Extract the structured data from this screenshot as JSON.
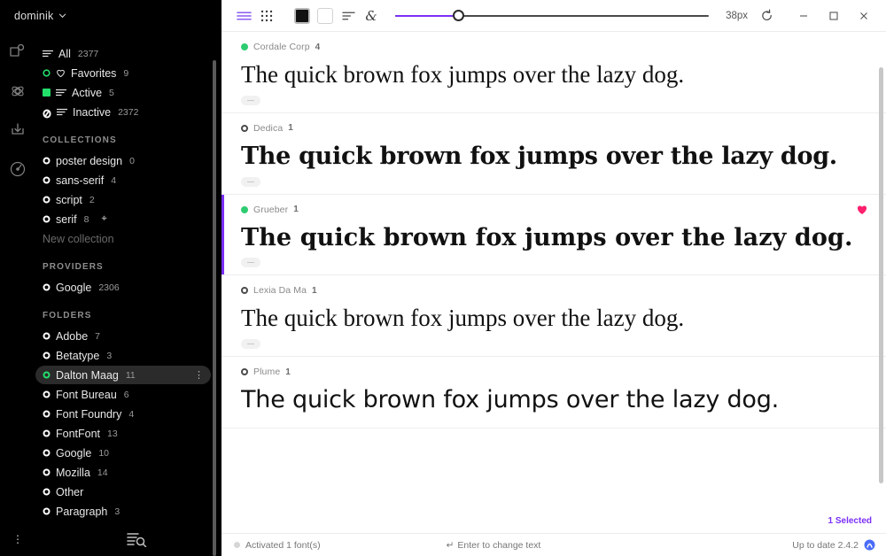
{
  "sidebar": {
    "user": {
      "name": "dominik",
      "chevron_icon": "chevron-down-icon"
    },
    "rail_icons": [
      "fonts-tag-icon",
      "settings-atom-icon",
      "install-download-icon",
      "broadcast-icon"
    ],
    "filters": [
      {
        "label": "All",
        "count": "2377",
        "icon": "lines-icon",
        "marker": "none"
      },
      {
        "label": "Favorites",
        "count": "9",
        "icon": "heart-icon",
        "marker": "ring-green"
      },
      {
        "label": "Active",
        "count": "5",
        "icon": "lines-icon",
        "marker": "square-green"
      },
      {
        "label": "Inactive",
        "count": "2372",
        "icon": "lines-icon",
        "marker": "slash-circle"
      }
    ],
    "collections_title": "COLLECTIONS",
    "collections": [
      {
        "label": "poster design",
        "count": "0"
      },
      {
        "label": "sans-serif",
        "count": "4"
      },
      {
        "label": "script",
        "count": "2"
      },
      {
        "label": "serif",
        "count": "8"
      }
    ],
    "new_collection_label": "New collection",
    "providers_title": "PROVIDERS",
    "providers": [
      {
        "label": "Google",
        "count": "2306"
      }
    ],
    "folders_title": "FOLDERS",
    "folders": [
      {
        "label": "Adobe",
        "count": "7",
        "selected": false
      },
      {
        "label": "Betatype",
        "count": "3",
        "selected": false
      },
      {
        "label": "Dalton Maag",
        "count": "11",
        "selected": true
      },
      {
        "label": "Font Bureau",
        "count": "6",
        "selected": false
      },
      {
        "label": "Font Foundry",
        "count": "4",
        "selected": false
      },
      {
        "label": "FontFont",
        "count": "13",
        "selected": false
      },
      {
        "label": "Google",
        "count": "10",
        "selected": false
      },
      {
        "label": "Mozilla",
        "count": "14",
        "selected": false
      },
      {
        "label": "Other",
        "count": "",
        "selected": false
      },
      {
        "label": "Paragraph",
        "count": "3",
        "selected": false
      }
    ],
    "footer": {
      "menu_icon": "more-vertical-icon",
      "search_icon": "list-search-icon"
    }
  },
  "toolbar": {
    "view_list_icon": "list-view-icon",
    "view_grid_icon": "grid-view-icon",
    "color_black_label": "black-swatch",
    "color_white_label": "white-swatch",
    "align_icon": "text-align-icon",
    "glyph_icon": "ampersand-glyph-icon",
    "size_value": "38px",
    "slider_percent": 20,
    "reset_icon": "reset-icon",
    "minimize_icon": "minimize-icon",
    "maximize_icon": "maximize-icon",
    "close_icon": "close-icon",
    "accent_color": "#7b2ff7"
  },
  "fonts": [
    {
      "name": "Cordale Corp",
      "count": "4",
      "marker": "dot-green",
      "favorite": false,
      "selected": false,
      "sample": "The quick brown fox jumps over the lazy dog."
    },
    {
      "name": "Dedica",
      "count": "1",
      "marker": "ring-dark",
      "favorite": false,
      "selected": false,
      "sample": "The quick brown fox jumps over the lazy dog."
    },
    {
      "name": "Grueber",
      "count": "1",
      "marker": "dot-green",
      "favorite": true,
      "selected": true,
      "sample": "The quick brown fox jumps over the lazy dog."
    },
    {
      "name": "Lexia Da Ma",
      "count": "1",
      "marker": "ring-dark",
      "favorite": false,
      "selected": false,
      "sample": "The quick brown fox jumps over the lazy dog."
    },
    {
      "name": "Plume",
      "count": "1",
      "marker": "ring-dark",
      "favorite": false,
      "selected": false,
      "sample": "The quick brown fox jumps over the lazy dog."
    }
  ],
  "selected_badge": "1 Selected",
  "statusbar": {
    "activated": "Activated 1 font(s)",
    "hint": "Enter to change text",
    "version": "Up to date 2.4.2",
    "logo_icon": "app-logo-icon",
    "enter_icon": "enter-key-icon"
  }
}
